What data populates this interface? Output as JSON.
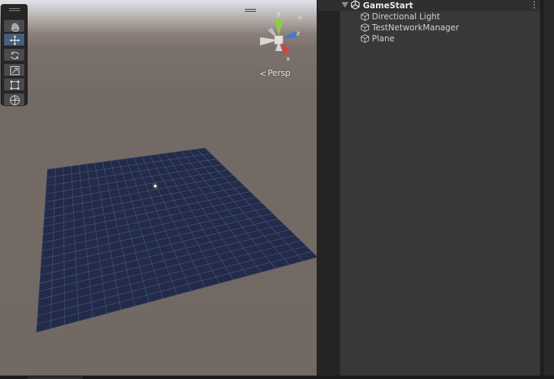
{
  "scene_view": {
    "camera_mode": "Persp",
    "gizmo_axes": [
      "y",
      "z",
      "x"
    ],
    "gizmo_colors": {
      "y": "#8ccf3a",
      "z": "#4478d8",
      "x": "#d9433a"
    },
    "tools": [
      {
        "name": "hand-tool",
        "icon": "hand-icon",
        "active": false
      },
      {
        "name": "move-tool",
        "icon": "move-arrows-icon",
        "active": true
      },
      {
        "name": "rotate-tool",
        "icon": "rotate-icon",
        "active": false
      },
      {
        "name": "scale-tool",
        "icon": "scale-icon",
        "active": false
      },
      {
        "name": "rect-tool",
        "icon": "rect-transform-icon",
        "active": false
      },
      {
        "name": "transform-tool",
        "icon": "transform-icon",
        "active": false
      }
    ],
    "plane_color": "#222b49",
    "grid_color": "#4a5a7a"
  },
  "hierarchy": {
    "scene_name": "GameStart",
    "objects": [
      {
        "label": "Directional Light",
        "icon": "gameobject-cube-icon"
      },
      {
        "label": "TestNetworkManager",
        "icon": "gameobject-cube-icon"
      },
      {
        "label": "Plane",
        "icon": "gameobject-cube-icon"
      }
    ],
    "menu_icon": "kebab-menu-icon"
  },
  "colors": {
    "active_tool": "#46607c",
    "panel_bg": "#383838",
    "text": "#d2d2d2"
  }
}
